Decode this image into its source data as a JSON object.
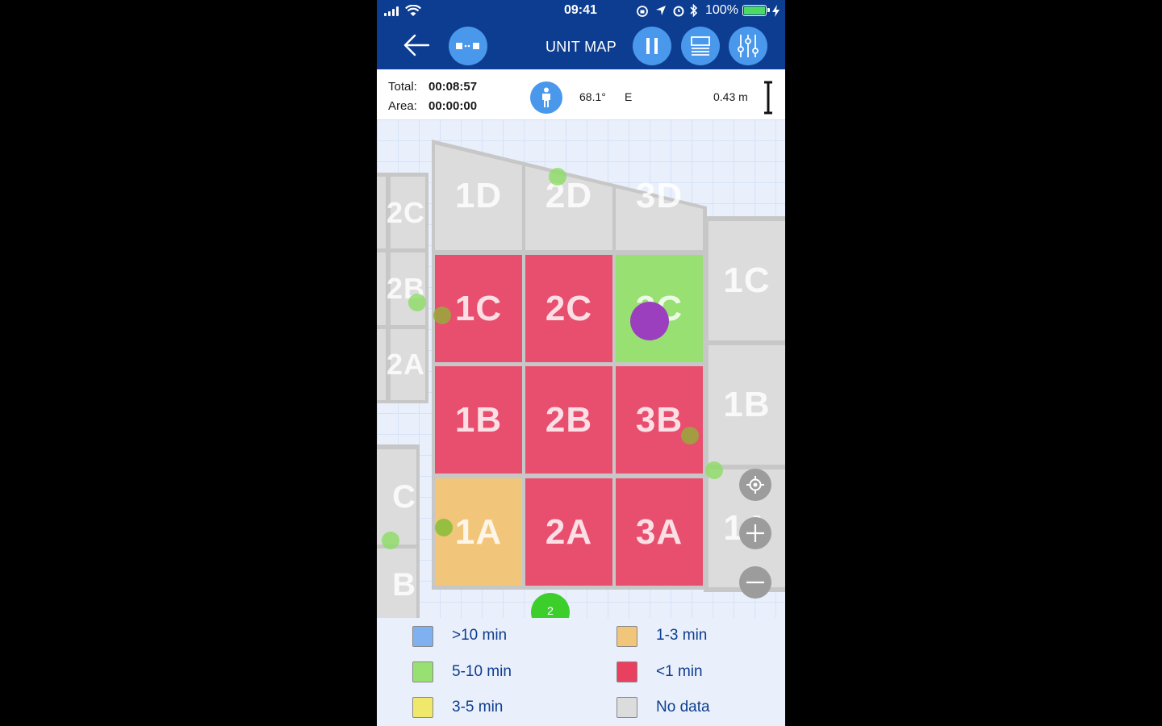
{
  "status_bar": {
    "time": "09:41",
    "battery": "100%"
  },
  "nav": {
    "title": "UNIT MAP"
  },
  "info": {
    "total_label": "Total:",
    "total_value": "00:08:57",
    "area_label": "Area:",
    "area_value": "00:00:00",
    "angle": "68.1°",
    "direction": "E",
    "distance": "0.43 m"
  },
  "map": {
    "cells_main": [
      {
        "label": "1D",
        "status": "No data"
      },
      {
        "label": "2D",
        "status": "No data"
      },
      {
        "label": "3D",
        "status": "No data"
      },
      {
        "label": "1C",
        "status": "<1 min"
      },
      {
        "label": "2C",
        "status": "<1 min"
      },
      {
        "label": "3C",
        "status": "5-10 min"
      },
      {
        "label": "1B",
        "status": "<1 min"
      },
      {
        "label": "2B",
        "status": "<1 min"
      },
      {
        "label": "3B",
        "status": "<1 min"
      },
      {
        "label": "1A",
        "status": "1-3 min"
      },
      {
        "label": "2A",
        "status": "<1 min"
      },
      {
        "label": "3A",
        "status": "<1 min"
      }
    ],
    "cells_left": [
      "2C",
      "2B",
      "2A",
      "C",
      "B"
    ],
    "cells_right": [
      "1C",
      "1B",
      "1A"
    ],
    "cluster_count": "2"
  },
  "legend": [
    {
      "label": ">10 min",
      "color": "#7fb0ef"
    },
    {
      "label": "1-3 min",
      "color": "#f2c67a"
    },
    {
      "label": "5-10 min",
      "color": "#98e072"
    },
    {
      "label": "<1 min",
      "color": "#e8405e"
    },
    {
      "label": "3-5 min",
      "color": "#f0e86a"
    },
    {
      "label": "No data",
      "color": "#dcdcdc"
    }
  ]
}
